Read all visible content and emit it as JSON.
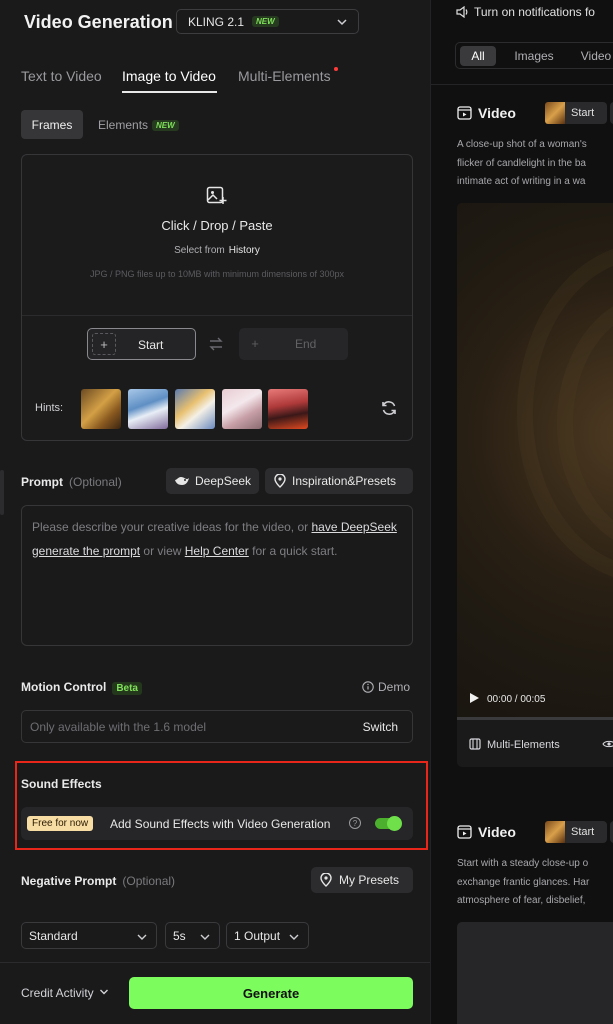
{
  "header": {
    "title": "Video Generation",
    "model": "KLING 2.1",
    "model_badge": "NEW"
  },
  "tabs": [
    {
      "label": "Text to Video"
    },
    {
      "label": "Image to Video"
    },
    {
      "label": "Multi-Elements"
    }
  ],
  "subtabs": {
    "frames": "Frames",
    "elements": "Elements",
    "elements_badge": "NEW"
  },
  "upload": {
    "title": "Click / Drop / Paste",
    "select_from": "Select from",
    "history": "History",
    "requirements": "JPG / PNG files up to 10MB with minimum dimensions of 300px",
    "start_label": "Start",
    "end_label": "End",
    "hints_label": "Hints:"
  },
  "prompt": {
    "label": "Prompt",
    "optional": "(Optional)",
    "deepseek_button": "DeepSeek",
    "inspiration_button": "Inspiration&Presets",
    "placeholder_1": "Please describe your creative ideas for the video, or ",
    "link_1": "have DeepSeek generate the prompt",
    "placeholder_2": " or view ",
    "link_2": "Help Center",
    "placeholder_3": " for a quick start."
  },
  "motion": {
    "label": "Motion Control",
    "badge": "Beta",
    "demo": "Demo",
    "placeholder": "Only available with the 1.6 model",
    "switch": "Switch"
  },
  "sound": {
    "label": "Sound Effects",
    "free_badge": "Free for now",
    "text": "Add Sound Effects with Video Generation",
    "help": "?",
    "enabled": true
  },
  "negative": {
    "label": "Negative Prompt",
    "optional": "(Optional)",
    "presets_button": "My Presets"
  },
  "settings": {
    "mode": "Standard",
    "duration": "5s",
    "outputs": "1 Output"
  },
  "footer": {
    "credit": "Credit Activity",
    "generate": "Generate"
  },
  "right": {
    "notification": "Turn on notifications fo",
    "filters": [
      {
        "label": "All"
      },
      {
        "label": "Images"
      },
      {
        "label": "Video"
      }
    ],
    "cards": [
      {
        "title": "Video",
        "start": "Start",
        "desc": [
          "A close-up shot of a woman's",
          "flicker of candlelight in the ba",
          "intimate act of writing in a wa"
        ],
        "time": "00:00 / 00:05",
        "multi": "Multi-Elements"
      },
      {
        "title": "Video",
        "start": "Start",
        "desc": [
          "Start with a steady close-up o",
          "exchange frantic glances. Har",
          "atmosphere of fear, disbelief,"
        ]
      }
    ]
  },
  "colors": {
    "accent": "#7dfc5e",
    "highlight": "#e8261a",
    "badge_green": "#7fe05a"
  }
}
